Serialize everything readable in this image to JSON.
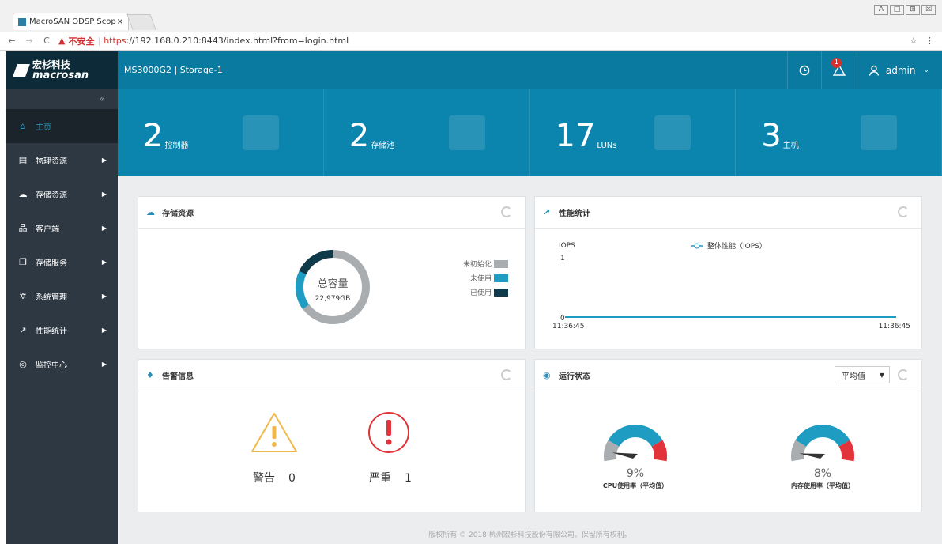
{
  "browser": {
    "tab_title": "MacroSAN ODSP Scop",
    "tab_close": "×",
    "security": "不安全",
    "url_scheme": "https",
    "url_rest": "://192.168.0.210:8443/index.html?from=login.html",
    "window_controls": [
      "A",
      "□",
      "⊞",
      "☒"
    ]
  },
  "brand": {
    "cn": "宏杉科技",
    "en": "macrosan"
  },
  "header": {
    "title": "MS3000G2 | Storage-1",
    "alert_count": "1",
    "user": "admin"
  },
  "sidebar": {
    "collapse": "«",
    "items": [
      {
        "label": "主页",
        "icon": "home-icon",
        "glyph": "⌂",
        "active": true
      },
      {
        "label": "物理资源",
        "icon": "server-icon",
        "glyph": "▤"
      },
      {
        "label": "存储资源",
        "icon": "cloud-icon",
        "glyph": "☁"
      },
      {
        "label": "客户端",
        "icon": "sitemap-icon",
        "glyph": "品"
      },
      {
        "label": "存储服务",
        "icon": "copy-icon",
        "glyph": "❐"
      },
      {
        "label": "系统管理",
        "icon": "gear-icon",
        "glyph": "✲"
      },
      {
        "label": "性能统计",
        "icon": "chart-icon",
        "glyph": "↗"
      },
      {
        "label": "监控中心",
        "icon": "dashboard-icon",
        "glyph": "◎"
      }
    ]
  },
  "stats": [
    {
      "value": "2",
      "label": "控制器",
      "icon": "server-icon"
    },
    {
      "value": "2",
      "label": "存储池",
      "icon": "cloud-icon"
    },
    {
      "value": "17",
      "label": "LUNs",
      "icon": "storage-grid-icon"
    },
    {
      "value": "3",
      "label": "主机",
      "icon": "sitemap-icon"
    }
  ],
  "storage_panel": {
    "title": "存储资源",
    "center_title": "总容量",
    "center_value": "22,979GB",
    "legend": [
      {
        "label": "未初始化",
        "color": "#a9adb0"
      },
      {
        "label": "未使用",
        "color": "#1e9cc2"
      },
      {
        "label": "已使用",
        "color": "#0f3a4a"
      }
    ]
  },
  "chart_data": {
    "type": "line",
    "title": "性能统计",
    "ylabel": "IOPS",
    "series": [
      {
        "name": "整体性能（IOPS）",
        "values": [
          0,
          0
        ]
      }
    ],
    "x": [
      "11:36:45",
      "11:36:45"
    ],
    "ylim": [
      0,
      1
    ],
    "y_ticks": [
      "1",
      "0"
    ],
    "color": "#1e9cc2"
  },
  "alarm_panel": {
    "title": "告警信息",
    "warning": {
      "label": "警告",
      "count": "0",
      "color": "#f0b84a"
    },
    "critical": {
      "label": "严重",
      "count": "1",
      "color": "#e3333a"
    }
  },
  "status_panel": {
    "title": "运行状态",
    "select_value": "平均值",
    "gauges": [
      {
        "value": "9%",
        "label": "CPU使用率（平均值）",
        "fraction": 0.09
      },
      {
        "value": "8%",
        "label": "内存使用率（平均值）",
        "fraction": 0.08
      }
    ]
  },
  "footer": "版权所有 © 2018 杭州宏杉科技股份有限公司。保留所有权利。"
}
